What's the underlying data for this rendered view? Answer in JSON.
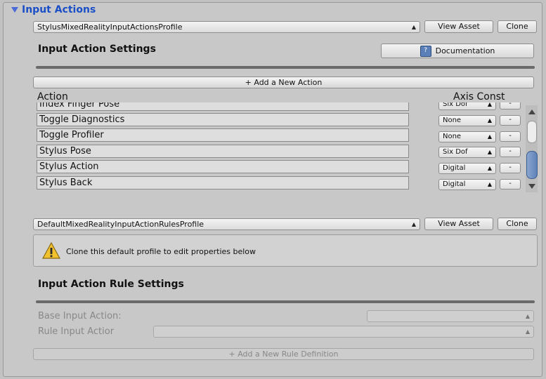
{
  "section": {
    "title": "Input Actions"
  },
  "profile": {
    "selected": "StylusMixedRealityInputActionsProfile",
    "view_asset": "View Asset",
    "clone": "Clone"
  },
  "settings": {
    "title": "Input Action Settings",
    "documentation": "Documentation"
  },
  "add_action": "+ Add a New Action",
  "table": {
    "col_action": "Action",
    "col_axis": "Axis Const",
    "rows": [
      {
        "name": "Index Finger Pose",
        "axis": "Six Dof",
        "remove": "-"
      },
      {
        "name": "Toggle Diagnostics",
        "axis": "None",
        "remove": "-"
      },
      {
        "name": "Toggle Profiler",
        "axis": "None",
        "remove": "-"
      },
      {
        "name": "Stylus Pose",
        "axis": "Six Dof",
        "remove": "-"
      },
      {
        "name": "Stylus Action",
        "axis": "Digital",
        "remove": "-"
      },
      {
        "name": "Stylus Back",
        "axis": "Digital",
        "remove": "-"
      }
    ]
  },
  "rules_profile": {
    "selected": "DefaultMixedRealityInputActionRulesProfile",
    "view_asset": "View Asset",
    "clone": "Clone"
  },
  "warning": {
    "text": "Clone this default profile to edit properties below"
  },
  "rule_settings": {
    "title": "Input Action Rule Settings",
    "base_label": "Base Input Action:",
    "rule_label": "Rule Input Actior",
    "add_rule": "+ Add a New Rule Definition"
  },
  "colors": {
    "accent": "#1b4fc7",
    "warning": "#f2c12e",
    "panel": "#c8c8c8"
  }
}
